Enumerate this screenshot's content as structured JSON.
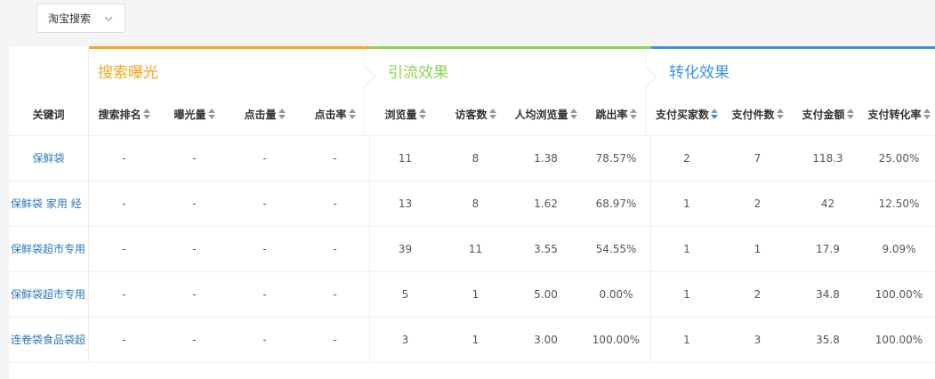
{
  "dropdown": {
    "value": "淘宝搜索"
  },
  "groups": {
    "search": {
      "title": "搜索曝光",
      "color": "#f5a623"
    },
    "traffic": {
      "title": "引流效果",
      "color": "#8ed24e"
    },
    "conversion": {
      "title": "转化效果",
      "color": "#3a95e0"
    }
  },
  "columns": [
    "关键词",
    "搜索排名",
    "曝光量",
    "点击量",
    "点击率",
    "浏览量",
    "访客数",
    "人均浏览量",
    "跳出率",
    "支付买家数",
    "支付件数",
    "支付金额",
    "支付转化率"
  ],
  "rows": [
    {
      "keyword": "保鲜袋",
      "cells": [
        "-",
        "-",
        "-",
        "-",
        "11",
        "8",
        "1.38",
        "78.57%",
        "2",
        "7",
        "118.3",
        "25.00%"
      ]
    },
    {
      "keyword": "保鲜袋 家用 经",
      "cells": [
        "-",
        "-",
        "-",
        "-",
        "13",
        "8",
        "1.62",
        "68.97%",
        "1",
        "2",
        "42",
        "12.50%"
      ]
    },
    {
      "keyword": "保鲜袋超市专用",
      "cells": [
        "-",
        "-",
        "-",
        "-",
        "39",
        "11",
        "3.55",
        "54.55%",
        "1",
        "1",
        "17.9",
        "9.09%"
      ]
    },
    {
      "keyword": "保鲜袋超市专用",
      "cells": [
        "-",
        "-",
        "-",
        "-",
        "5",
        "1",
        "5.00",
        "0.00%",
        "1",
        "2",
        "34.8",
        "100.00%"
      ]
    },
    {
      "keyword": "连卷袋食品袋超",
      "cells": [
        "-",
        "-",
        "-",
        "-",
        "3",
        "1",
        "3.00",
        "100.00%",
        "1",
        "3",
        "35.8",
        "100.00%"
      ]
    }
  ]
}
